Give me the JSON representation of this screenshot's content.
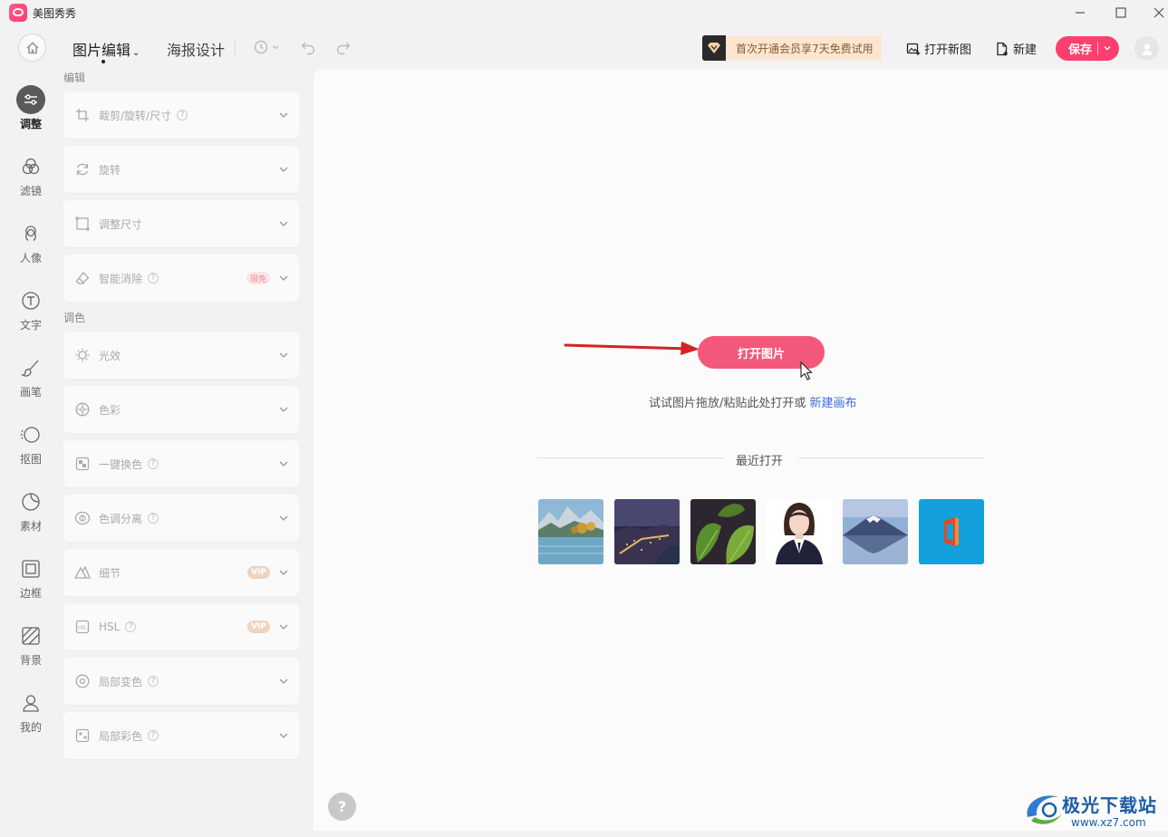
{
  "app": {
    "title": "美图秀秀"
  },
  "toolbar": {
    "tabs": [
      {
        "label": "图片编辑"
      },
      {
        "label": "海报设计"
      }
    ],
    "vip_banner": "首次开通会员享7天免费试用",
    "open_new_label": "打开新图",
    "new_label": "新建",
    "save_label": "保存"
  },
  "rail": [
    {
      "label": "调整",
      "icon": "sliders-icon",
      "active": true
    },
    {
      "label": "滤镜",
      "icon": "filter-icon"
    },
    {
      "label": "人像",
      "icon": "portrait-icon"
    },
    {
      "label": "文字",
      "icon": "text-icon"
    },
    {
      "label": "画笔",
      "icon": "brush-icon"
    },
    {
      "label": "抠图",
      "icon": "cutout-icon"
    },
    {
      "label": "素材",
      "icon": "sticker-icon"
    },
    {
      "label": "边框",
      "icon": "frame-icon"
    },
    {
      "label": "背景",
      "icon": "background-icon"
    },
    {
      "label": "我的",
      "icon": "user-icon"
    }
  ],
  "panel": {
    "section_edit": "编辑",
    "section_color": "调色",
    "edit_items": [
      {
        "label": "裁剪/旋转/尺寸",
        "icon": "crop-icon",
        "help": true
      },
      {
        "label": "旋转",
        "icon": "rotate-icon"
      },
      {
        "label": "调整尺寸",
        "icon": "resize-icon"
      },
      {
        "label": "智能消除",
        "icon": "eraser-icon",
        "help": true,
        "tag": "限免"
      }
    ],
    "color_items": [
      {
        "label": "光效",
        "icon": "sun-icon"
      },
      {
        "label": "色彩",
        "icon": "palette-icon"
      },
      {
        "label": "一键换色",
        "icon": "swap-color-icon",
        "help": true
      },
      {
        "label": "色调分离",
        "icon": "tone-split-icon",
        "help": true
      },
      {
        "label": "细节",
        "icon": "detail-icon",
        "tag": "VIP"
      },
      {
        "label": "HSL",
        "icon": "hsl-icon",
        "help": true,
        "tag": "VIP"
      },
      {
        "label": "局部变色",
        "icon": "local-color-change-icon",
        "help": true
      },
      {
        "label": "局部彩色",
        "icon": "local-color-icon",
        "help": true
      }
    ]
  },
  "workspace": {
    "open_button": "打开图片",
    "hint_text": "试试图片拖放/粘贴此处打开或",
    "hint_link": "新建画布",
    "recent_title": "最近打开",
    "recent_thumbs": [
      "lake-autumn-thumb",
      "city-night-thumb",
      "green-leaves-thumb",
      "portrait-girl-thumb",
      "mount-fuji-thumb",
      "office-logo-thumb"
    ]
  },
  "watermark": {
    "name": "极光下载站",
    "url": "www.xz7.com"
  },
  "colors": {
    "accent": "#fc3f6e",
    "open_button": "#f3587a",
    "link": "#3d6fd4"
  }
}
